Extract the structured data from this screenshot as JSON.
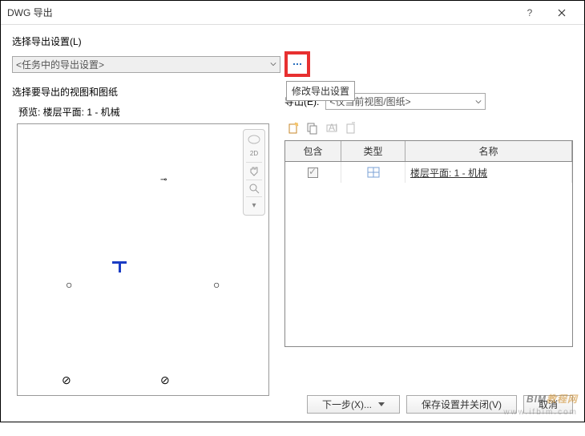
{
  "window": {
    "title": "DWG 导出",
    "help": "?",
    "close": "X"
  },
  "select_export_settings_label": "选择导出设置(L)",
  "export_settings_combo": "<任务中的导出设置>",
  "ellipsis_tooltip": "修改导出设置",
  "section_views_label": "选择要导出的视图和图纸",
  "preview_label": "预览: 楼层平面: 1 - 机械",
  "export_label": "导出(E):",
  "export_combo": "<仅当前视图/图纸>",
  "grid": {
    "headers": {
      "include": "包含",
      "type": "类型",
      "name": "名称"
    },
    "rows": [
      {
        "included": true,
        "type_icon": "sheet-icon",
        "name": "楼层平面: 1 - 机械"
      }
    ]
  },
  "buttons": {
    "next": "下一步(X)...",
    "save_close": "保存设置并关闭(V)",
    "cancel": "取消"
  },
  "watermark": {
    "line1_a": "BIM",
    "line1_b": "教程网",
    "line2": "www.ifbim.com"
  },
  "viewcube_2d": "2D"
}
